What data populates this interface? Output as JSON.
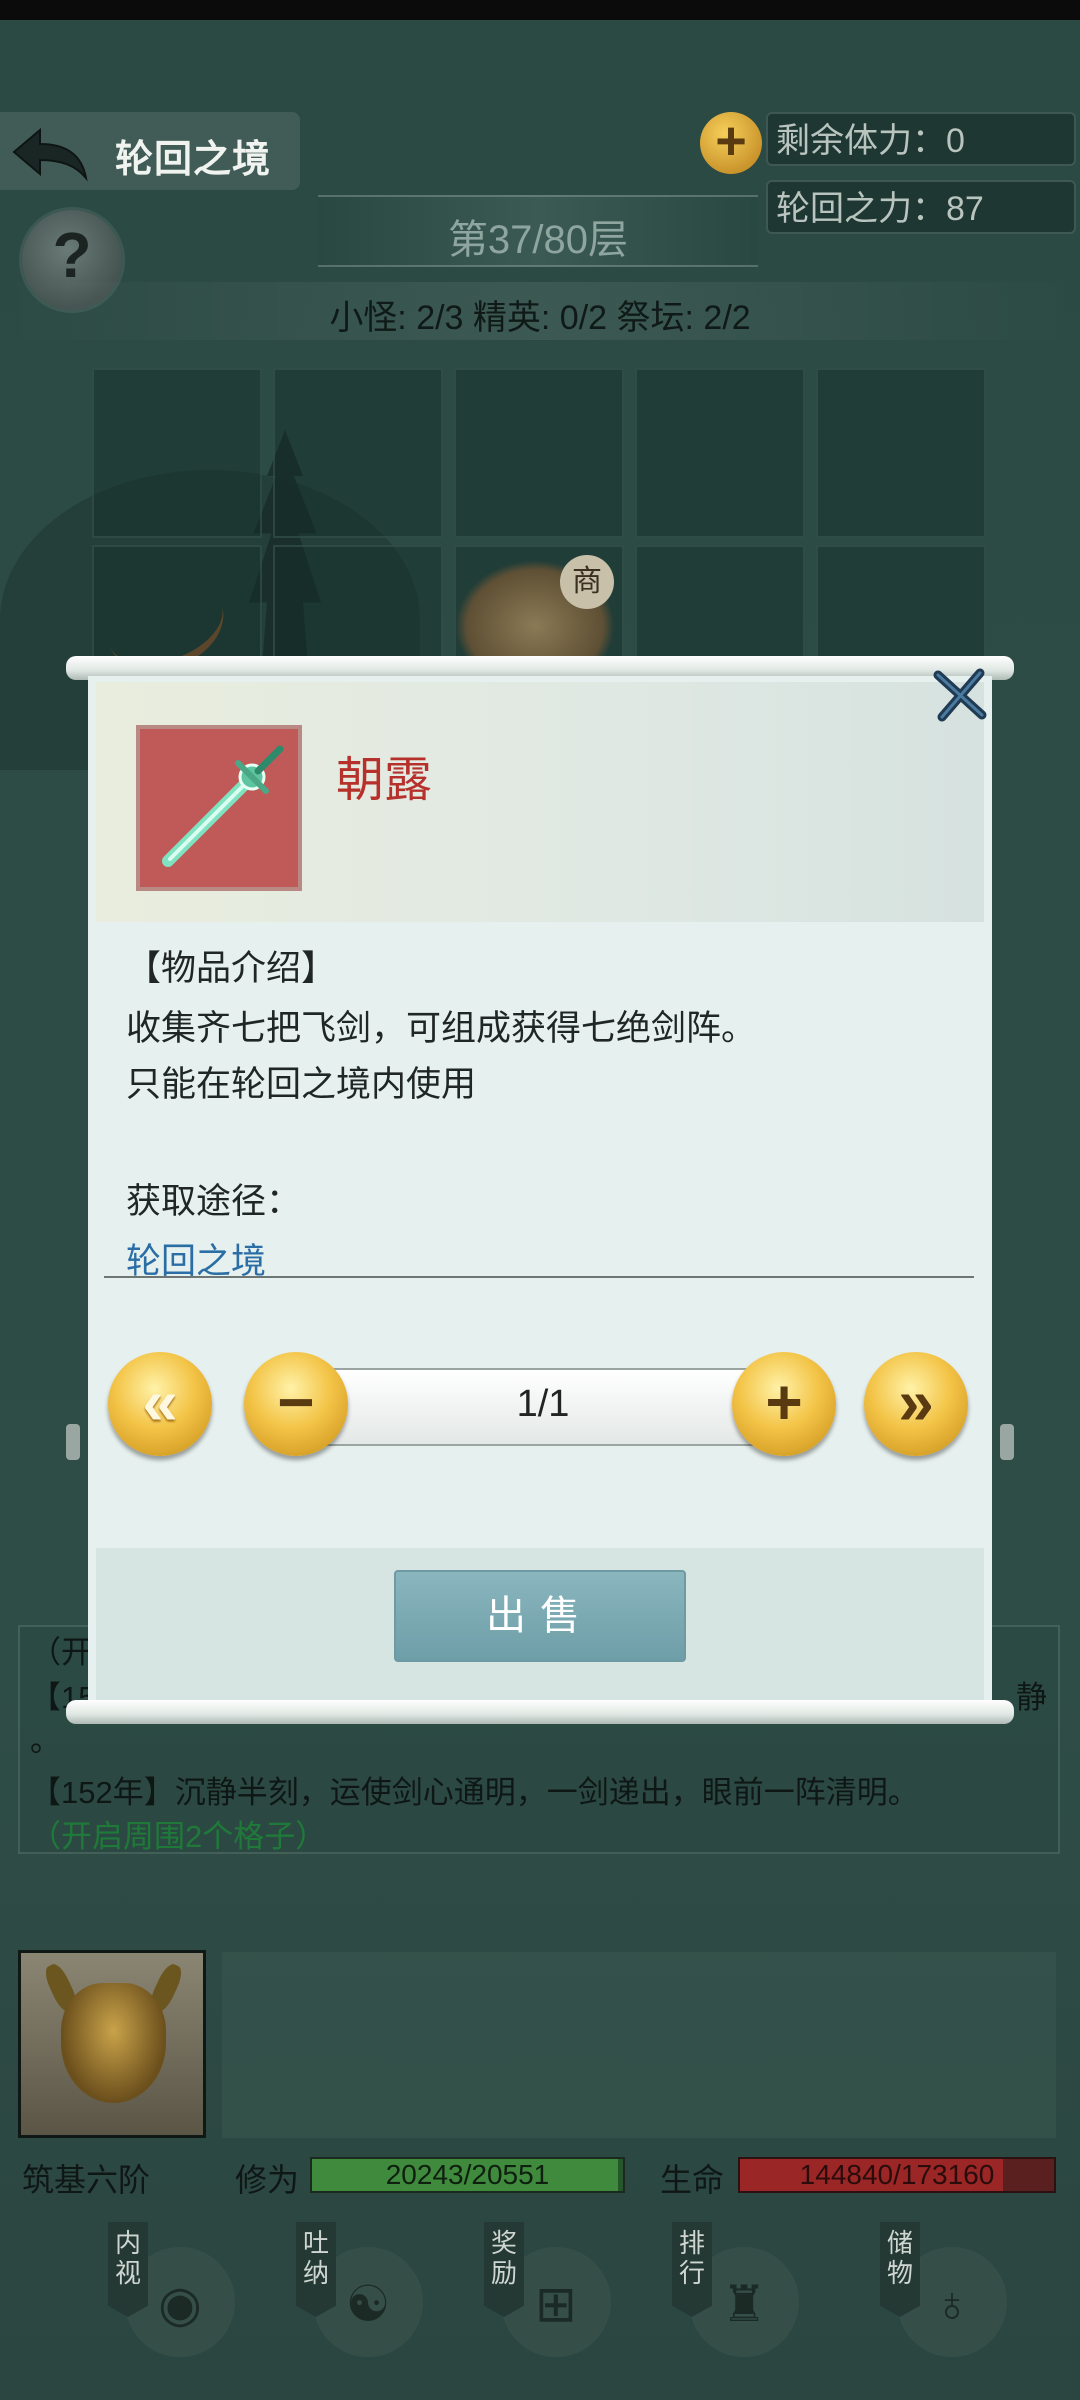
{
  "screen": {
    "title": "轮回之境",
    "help_label": "?"
  },
  "stats": {
    "plus_label": "+",
    "stamina": "剩余体力：0",
    "power": "轮回之力：87"
  },
  "floor": {
    "label": "第37/80层"
  },
  "counts": {
    "text": "小怪: 2/3 精英: 0/2 祭坛: 2/2"
  },
  "board": {
    "merchant_tag": "商"
  },
  "dialog": {
    "item_name": "朝露",
    "section_title": "【物品介绍】",
    "desc_lines": [
      "收集齐七把飞剑，可组成获得七绝剑阵。",
      "只能在轮回之境内使用"
    ],
    "source_title": "获取途径：",
    "source_link": "轮回之境",
    "quantity": "1/1",
    "quantity_fraction": 1.0,
    "first_label": "«",
    "minus_label": "−",
    "plus_label": "+",
    "last_label": "»",
    "sell_label": "出售",
    "close_label": "✕"
  },
  "log": {
    "lines": [
      "（开",
      "【15",
      "。",
      "【152年】沉静半刻，运使剑心通明，一剑递出，眼前一阵清明。"
    ],
    "trailing_fragment": "静",
    "green_note": "（开启周围2个格子）"
  },
  "player": {
    "realm": "筑基六阶",
    "cultivation_label": "修为",
    "cultivation_value": "20243/20551",
    "cultivation_fraction": 0.985,
    "hp_label": "生命",
    "hp_value": "144840/173160",
    "hp_fraction": 0.836
  },
  "nav": [
    {
      "label": "内视",
      "icon": "eye-icon"
    },
    {
      "label": "吐纳",
      "icon": "meditation-icon"
    },
    {
      "label": "奖励",
      "icon": "gift-icon"
    },
    {
      "label": "排行",
      "icon": "ranking-icon"
    },
    {
      "label": "储物",
      "icon": "bag-icon"
    }
  ]
}
